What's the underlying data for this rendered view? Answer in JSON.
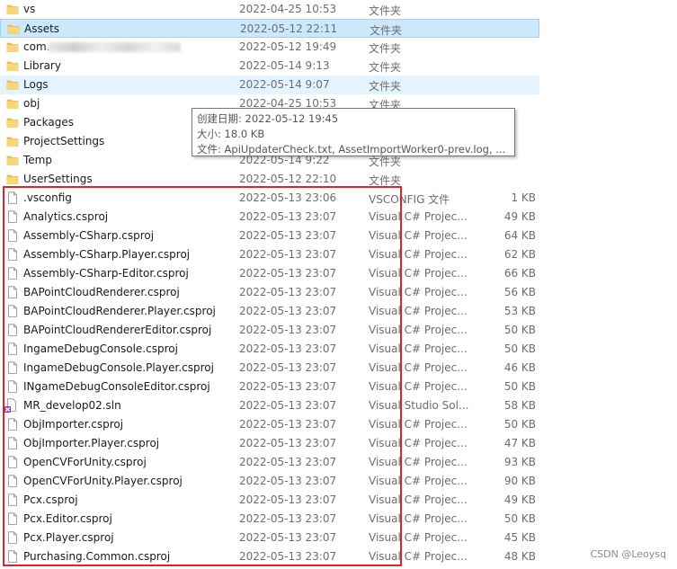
{
  "colors": {
    "selected_bg": "#cce8ff",
    "hover_bg": "#e5f3ff",
    "folder": "#f3c35a",
    "highlight_box": "#d9262e"
  },
  "items": [
    {
      "name": "vs",
      "date": "2022-04-25 10:53",
      "type": "文件夹",
      "size": "",
      "kind": "folder",
      "state": ""
    },
    {
      "name": "Assets",
      "date": "2022-05-12 22:11",
      "type": "文件夹",
      "size": "",
      "kind": "folder",
      "state": "selected"
    },
    {
      "name": "com.",
      "date": "2022-05-12 19:49",
      "type": "文件夹",
      "size": "",
      "kind": "folder",
      "state": "",
      "redacted": true
    },
    {
      "name": "Library",
      "date": "2022-05-14 9:13",
      "type": "文件夹",
      "size": "",
      "kind": "folder",
      "state": ""
    },
    {
      "name": "Logs",
      "date": "2022-05-14 9:07",
      "type": "文件夹",
      "size": "",
      "kind": "folder",
      "state": "hover"
    },
    {
      "name": "obj",
      "date": "2022-04-25 10:53",
      "type": "文件夹",
      "size": "",
      "kind": "folder",
      "state": ""
    },
    {
      "name": "Packages",
      "date": "",
      "type": "",
      "size": "",
      "kind": "folder",
      "state": ""
    },
    {
      "name": "ProjectSettings",
      "date": "",
      "type": "",
      "size": "",
      "kind": "folder",
      "state": ""
    },
    {
      "name": "Temp",
      "date": "2022-05-14 9:22",
      "type": "文件夹",
      "size": "",
      "kind": "folder",
      "state": ""
    },
    {
      "name": "UserSettings",
      "date": "2022-05-12 22:10",
      "type": "文件夹",
      "size": "",
      "kind": "folder",
      "state": ""
    },
    {
      "name": ".vsconfig",
      "date": "2022-05-13 23:06",
      "type": "VSCONFIG 文件",
      "size": "1 KB",
      "kind": "file",
      "state": ""
    },
    {
      "name": "Analytics.csproj",
      "date": "2022-05-13 23:07",
      "type": "Visual C# Projec...",
      "size": "49 KB",
      "kind": "file",
      "state": ""
    },
    {
      "name": "Assembly-CSharp.csproj",
      "date": "2022-05-13 23:07",
      "type": "Visual C# Projec...",
      "size": "64 KB",
      "kind": "file",
      "state": ""
    },
    {
      "name": "Assembly-CSharp.Player.csproj",
      "date": "2022-05-13 23:07",
      "type": "Visual C# Projec...",
      "size": "62 KB",
      "kind": "file",
      "state": ""
    },
    {
      "name": "Assembly-CSharp-Editor.csproj",
      "date": "2022-05-13 23:07",
      "type": "Visual C# Projec...",
      "size": "66 KB",
      "kind": "file",
      "state": ""
    },
    {
      "name": "BAPointCloudRenderer.csproj",
      "date": "2022-05-13 23:07",
      "type": "Visual C# Projec...",
      "size": "56 KB",
      "kind": "file",
      "state": ""
    },
    {
      "name": "BAPointCloudRenderer.Player.csproj",
      "date": "2022-05-13 23:07",
      "type": "Visual C# Projec...",
      "size": "53 KB",
      "kind": "file",
      "state": ""
    },
    {
      "name": "BAPointCloudRendererEditor.csproj",
      "date": "2022-05-13 23:07",
      "type": "Visual C# Projec...",
      "size": "50 KB",
      "kind": "file",
      "state": ""
    },
    {
      "name": "IngameDebugConsole.csproj",
      "date": "2022-05-13 23:07",
      "type": "Visual C# Projec...",
      "size": "50 KB",
      "kind": "file",
      "state": ""
    },
    {
      "name": "IngameDebugConsole.Player.csproj",
      "date": "2022-05-13 23:07",
      "type": "Visual C# Projec...",
      "size": "46 KB",
      "kind": "file",
      "state": ""
    },
    {
      "name": "INgameDebugConsoleEditor.csproj",
      "date": "2022-05-13 23:07",
      "type": "Visual C# Projec...",
      "size": "50 KB",
      "kind": "file",
      "state": ""
    },
    {
      "name": "MR_develop02.sln",
      "date": "2022-05-13 23:07",
      "type": "Visual Studio Sol...",
      "size": "58 KB",
      "kind": "sln",
      "state": ""
    },
    {
      "name": "ObjImporter.csproj",
      "date": "2022-05-13 23:07",
      "type": "Visual C# Projec...",
      "size": "50 KB",
      "kind": "file",
      "state": ""
    },
    {
      "name": "ObjImporter.Player.csproj",
      "date": "2022-05-13 23:07",
      "type": "Visual C# Projec...",
      "size": "47 KB",
      "kind": "file",
      "state": ""
    },
    {
      "name": "OpenCVForUnity.csproj",
      "date": "2022-05-13 23:07",
      "type": "Visual C# Projec...",
      "size": "93 KB",
      "kind": "file",
      "state": ""
    },
    {
      "name": "OpenCVForUnity.Player.csproj",
      "date": "2022-05-13 23:07",
      "type": "Visual C# Projec...",
      "size": "90 KB",
      "kind": "file",
      "state": ""
    },
    {
      "name": "Pcx.csproj",
      "date": "2022-05-13 23:07",
      "type": "Visual C# Projec...",
      "size": "49 KB",
      "kind": "file",
      "state": ""
    },
    {
      "name": "Pcx.Editor.csproj",
      "date": "2022-05-13 23:07",
      "type": "Visual C# Projec...",
      "size": "50 KB",
      "kind": "file",
      "state": ""
    },
    {
      "name": "Pcx.Player.csproj",
      "date": "2022-05-13 23:07",
      "type": "Visual C# Projec...",
      "size": "45 KB",
      "kind": "file",
      "state": ""
    },
    {
      "name": "Purchasing.Common.csproj",
      "date": "2022-05-13 23:07",
      "type": "Visual C# Projec...",
      "size": "48 KB",
      "kind": "file",
      "state": ""
    }
  ],
  "tooltip": {
    "created": "创建日期: 2022-05-12 19:45",
    "size": "大小: 18.0 KB",
    "files": "文件: ApiUpdaterCheck.txt, AssetImportWorker0-prev.log, ..."
  },
  "watermark": "CSDN @Leoysq"
}
